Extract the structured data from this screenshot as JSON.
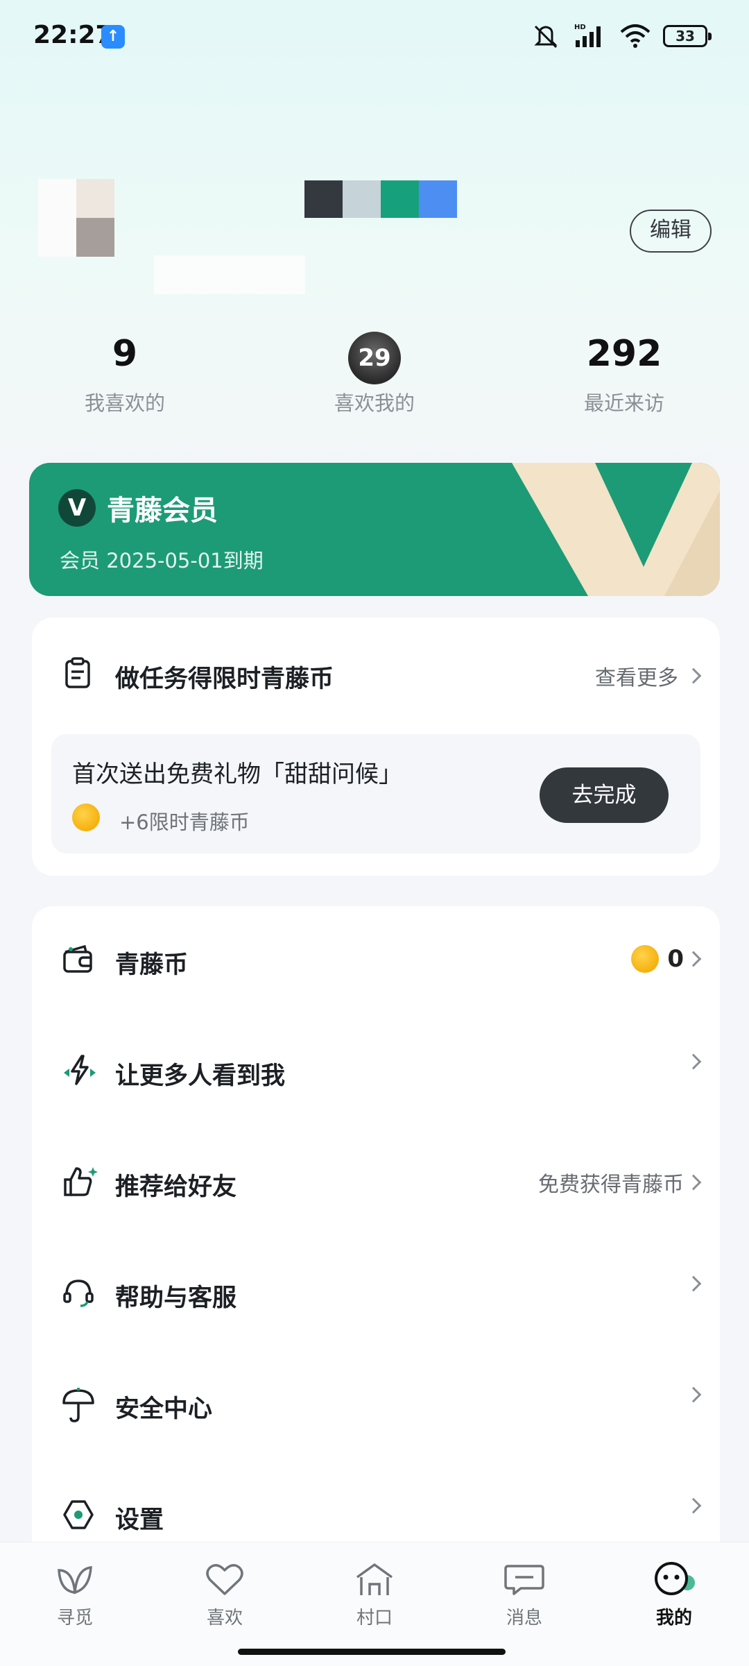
{
  "status_bar": {
    "time": "22:27",
    "battery": "33",
    "icons": [
      "upload-notification-icon",
      "mute-icon",
      "hd-signal-icon",
      "wifi-icon",
      "battery-icon"
    ]
  },
  "profile": {
    "edit_label": "编辑"
  },
  "stats": [
    {
      "value": "9",
      "label": "我喜欢的"
    },
    {
      "value": "29",
      "label": "喜欢我的"
    },
    {
      "value": "292",
      "label": "最近来访"
    }
  ],
  "vip": {
    "logo": "V",
    "title": "青藤会员",
    "subtitle": "会员 2025-05-01到期",
    "color": "#1c9b76"
  },
  "tasks": {
    "title": "做任务得限时青藤币",
    "more_label": "查看更多",
    "item": {
      "title": "首次送出免费礼物「甜甜问候」",
      "reward": "+6限时青藤币",
      "button": "去完成"
    }
  },
  "menu": [
    {
      "label": "青藤币",
      "right": "0",
      "icon": "wallet-icon"
    },
    {
      "label": "让更多人看到我",
      "right": "",
      "icon": "lightning-icon"
    },
    {
      "label": "推荐给好友",
      "right": "免费获得青藤币",
      "icon": "thumbs-up-icon"
    },
    {
      "label": "帮助与客服",
      "right": "",
      "icon": "headset-icon"
    },
    {
      "label": "安全中心",
      "right": "",
      "icon": "umbrella-icon"
    },
    {
      "label": "设置",
      "right": "",
      "icon": "settings-hexagon-icon"
    }
  ],
  "nav": [
    {
      "label": "寻觅",
      "icon": "leaf-icon"
    },
    {
      "label": "喜欢",
      "icon": "heart-icon"
    },
    {
      "label": "村口",
      "icon": "house-icon"
    },
    {
      "label": "消息",
      "icon": "message-icon"
    },
    {
      "label": "我的",
      "icon": "profile-face-icon",
      "active": true
    }
  ],
  "colors": {
    "accent": "#1c9b76",
    "dark_button": "#33383d",
    "coin": "#f5b10e"
  }
}
